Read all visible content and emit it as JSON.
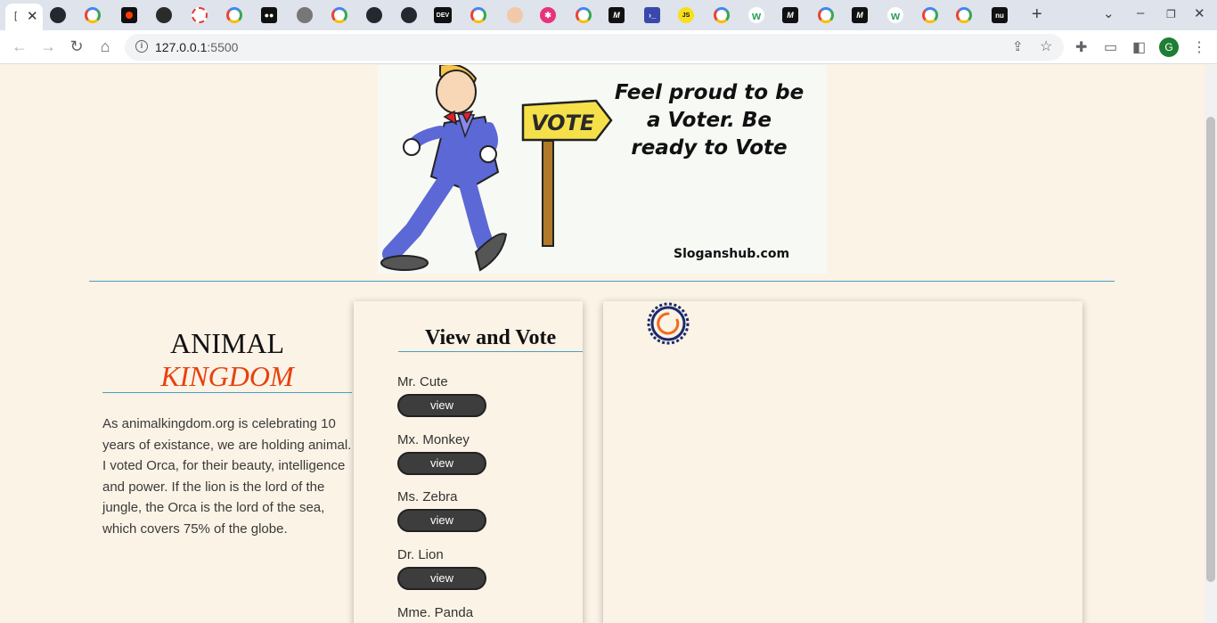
{
  "browser": {
    "active_tab_favicon": "[",
    "url_host": "127.0.0.1",
    "url_port": ":5500",
    "profile_initial": "G"
  },
  "banner": {
    "slogan": "Feel proud to be a Voter. Be ready to Vote",
    "sign_text": "VOTE",
    "site": "Sloganshub.com"
  },
  "brand": {
    "line1": "ANIMAL",
    "line2": "KINGDOM"
  },
  "blurb": "As animalkingdom.org is celebrating 10 years of existance, we are holding animal. I voted Orca, for their beauty, intelligence and power. If the lion is the lord of the jungle, the Orca is the lord of the sea, which covers 75% of the globe.",
  "vote": {
    "title": "View and Vote",
    "button_label": "view",
    "candidates": [
      {
        "name": "Mr. Cute"
      },
      {
        "name": "Mx. Monkey"
      },
      {
        "name": "Ms. Zebra"
      },
      {
        "name": "Dr. Lion"
      },
      {
        "name": "Mme. Panda"
      }
    ]
  },
  "colors": {
    "background": "#fbf3e6",
    "accent_rule": "#4a9fc4",
    "brand_orange": "#e8410e",
    "button": "#3d3d3d",
    "spinner_navy": "#1b2a6b",
    "spinner_orange": "#f26a1b"
  },
  "icons": [
    "back-icon",
    "forward-icon",
    "reload-icon",
    "home-icon",
    "info-icon",
    "share-icon",
    "star-icon",
    "extensions-icon",
    "cast-icon",
    "sidepanel-icon",
    "menu-icon",
    "loading-spinner-icon"
  ]
}
